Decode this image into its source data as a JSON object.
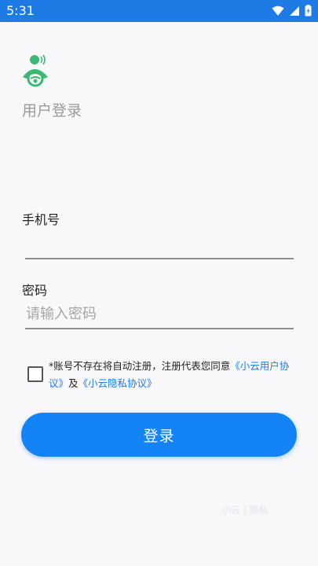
{
  "status_bar": {
    "time": "5:31",
    "icons": [
      "wifi-icon",
      "signal-icon",
      "battery-icon"
    ]
  },
  "header": {
    "title": "用户登录"
  },
  "form": {
    "phone_label": "手机号",
    "phone_value": "",
    "phone_placeholder": "",
    "password_label": "密码",
    "password_value": "",
    "password_placeholder": "请输入密码"
  },
  "agreement": {
    "checked": false,
    "prefix": "*账号不存在将自动注册，注册代表您同意",
    "user_agreement_link": "《小云用户协议》",
    "conjunction": "及",
    "privacy_link": "《小云隐私协议》"
  },
  "login_button": {
    "label": "登录"
  },
  "footer": {
    "faint_text": "小云 | 隐私"
  },
  "colors": {
    "accent": "#1383f6",
    "link": "#1e7be6",
    "logo_green": "#3cb874"
  }
}
